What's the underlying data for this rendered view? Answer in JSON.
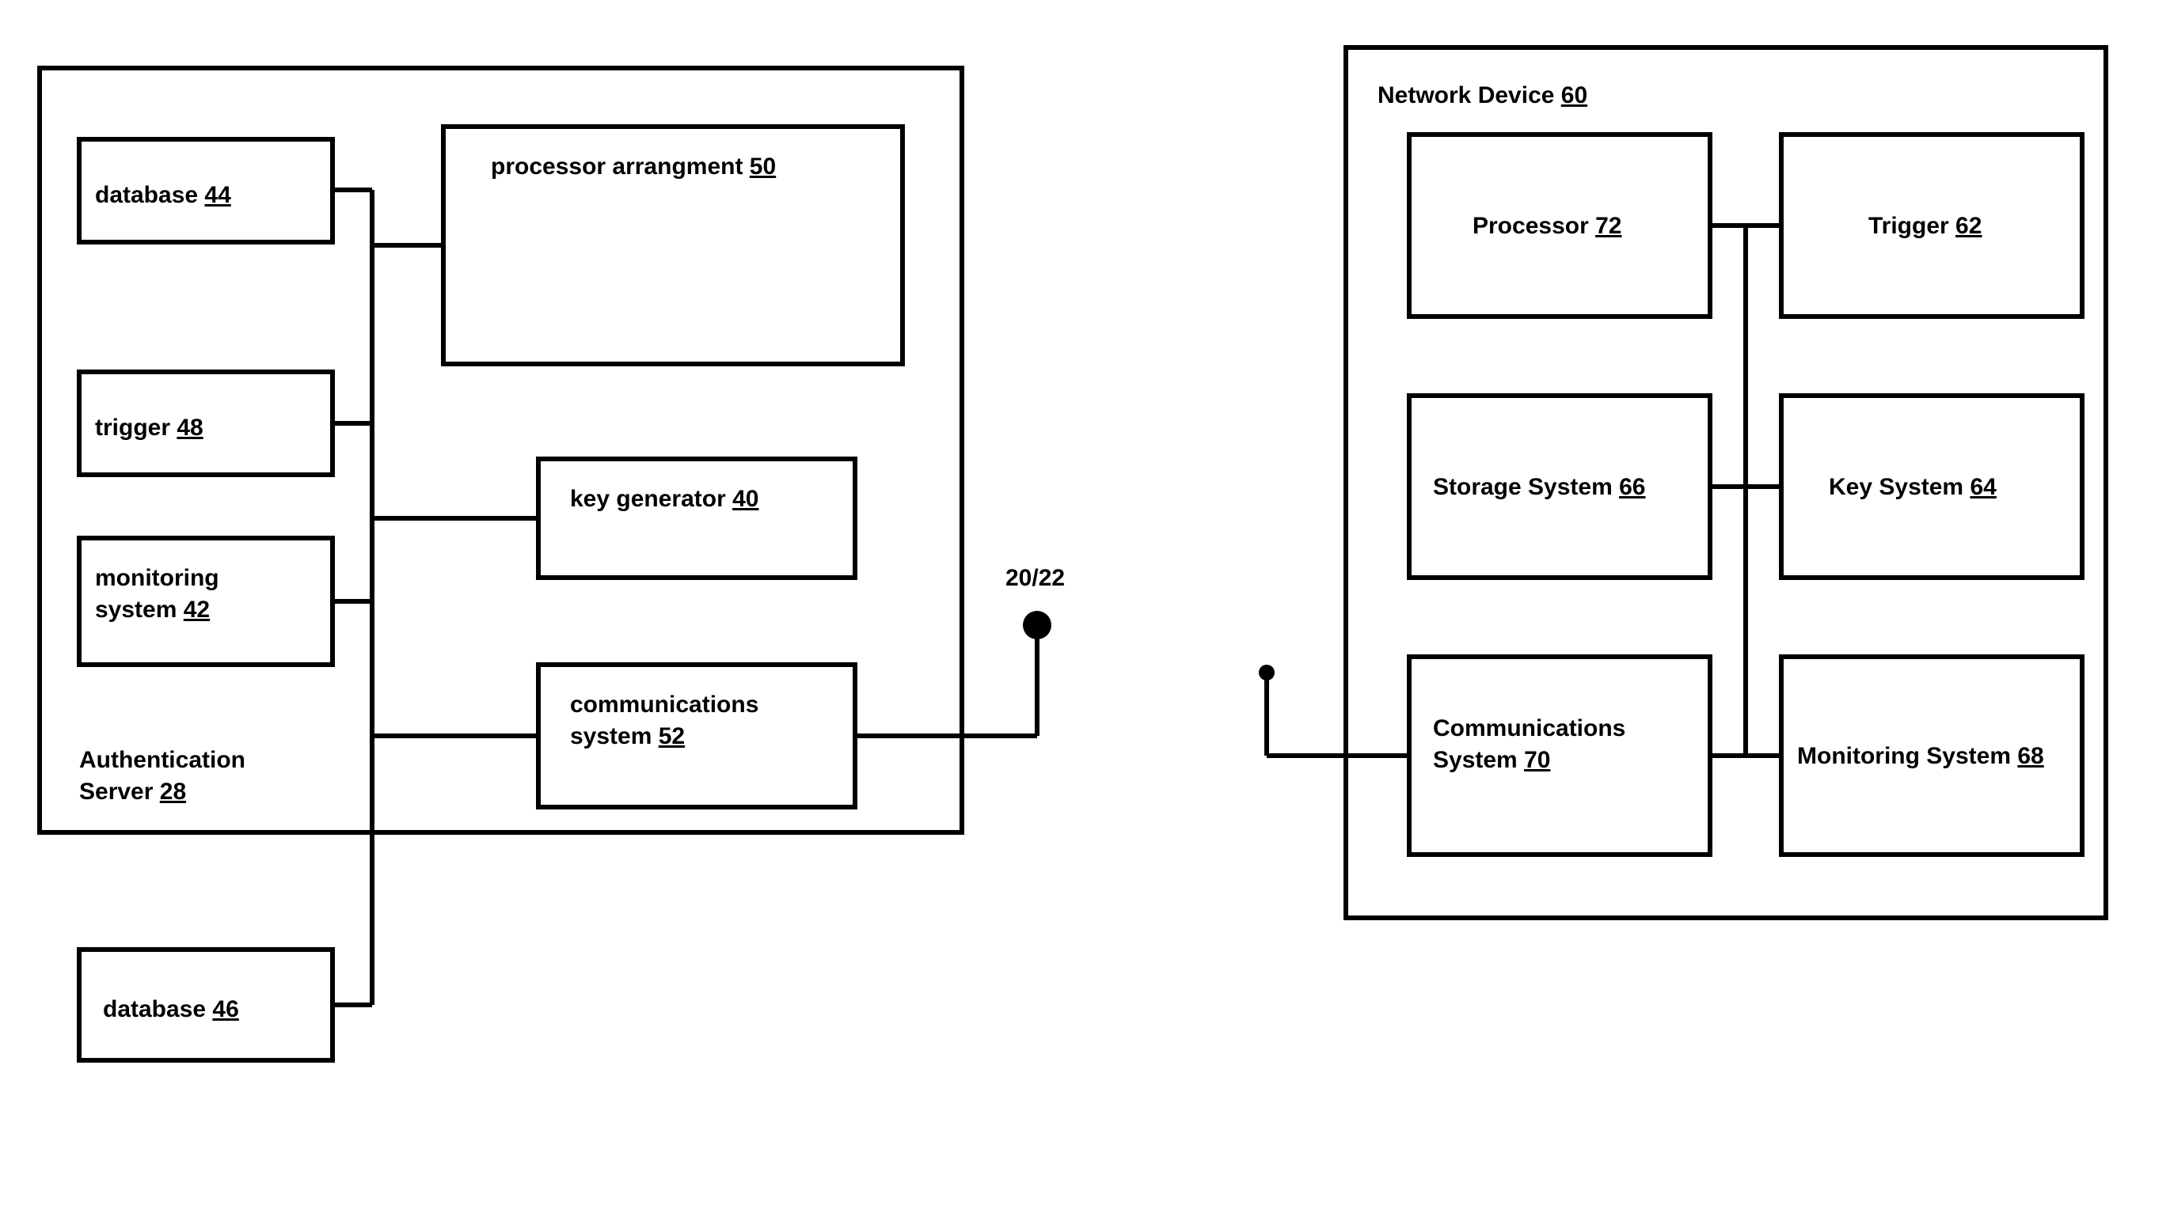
{
  "left": {
    "container_label": "Authentication Server",
    "container_ref": "28",
    "database_a": {
      "label": "database",
      "ref": "44"
    },
    "trigger": {
      "label": "trigger",
      "ref": "48"
    },
    "monitoring": {
      "label": "monitoring system",
      "ref": "42"
    },
    "processor": {
      "label": "processor arrangment",
      "ref": "50"
    },
    "keygen": {
      "label": "key generator",
      "ref": "40"
    },
    "comms": {
      "label": "communications system",
      "ref": "52"
    },
    "database_b": {
      "label": "database",
      "ref": "46"
    }
  },
  "mid_annotation": "20/22",
  "right": {
    "container_label": "Network Device",
    "container_ref": "60",
    "processor": {
      "label": "Processor",
      "ref": "72"
    },
    "trigger": {
      "label": "Trigger",
      "ref": "62"
    },
    "storage": {
      "label": "Storage System",
      "ref": "66"
    },
    "keysys": {
      "label": "Key System",
      "ref": "64"
    },
    "comms": {
      "label": "Communications System",
      "ref": "70"
    },
    "monitoring": {
      "label": "Monitoring System",
      "ref": "68"
    }
  }
}
